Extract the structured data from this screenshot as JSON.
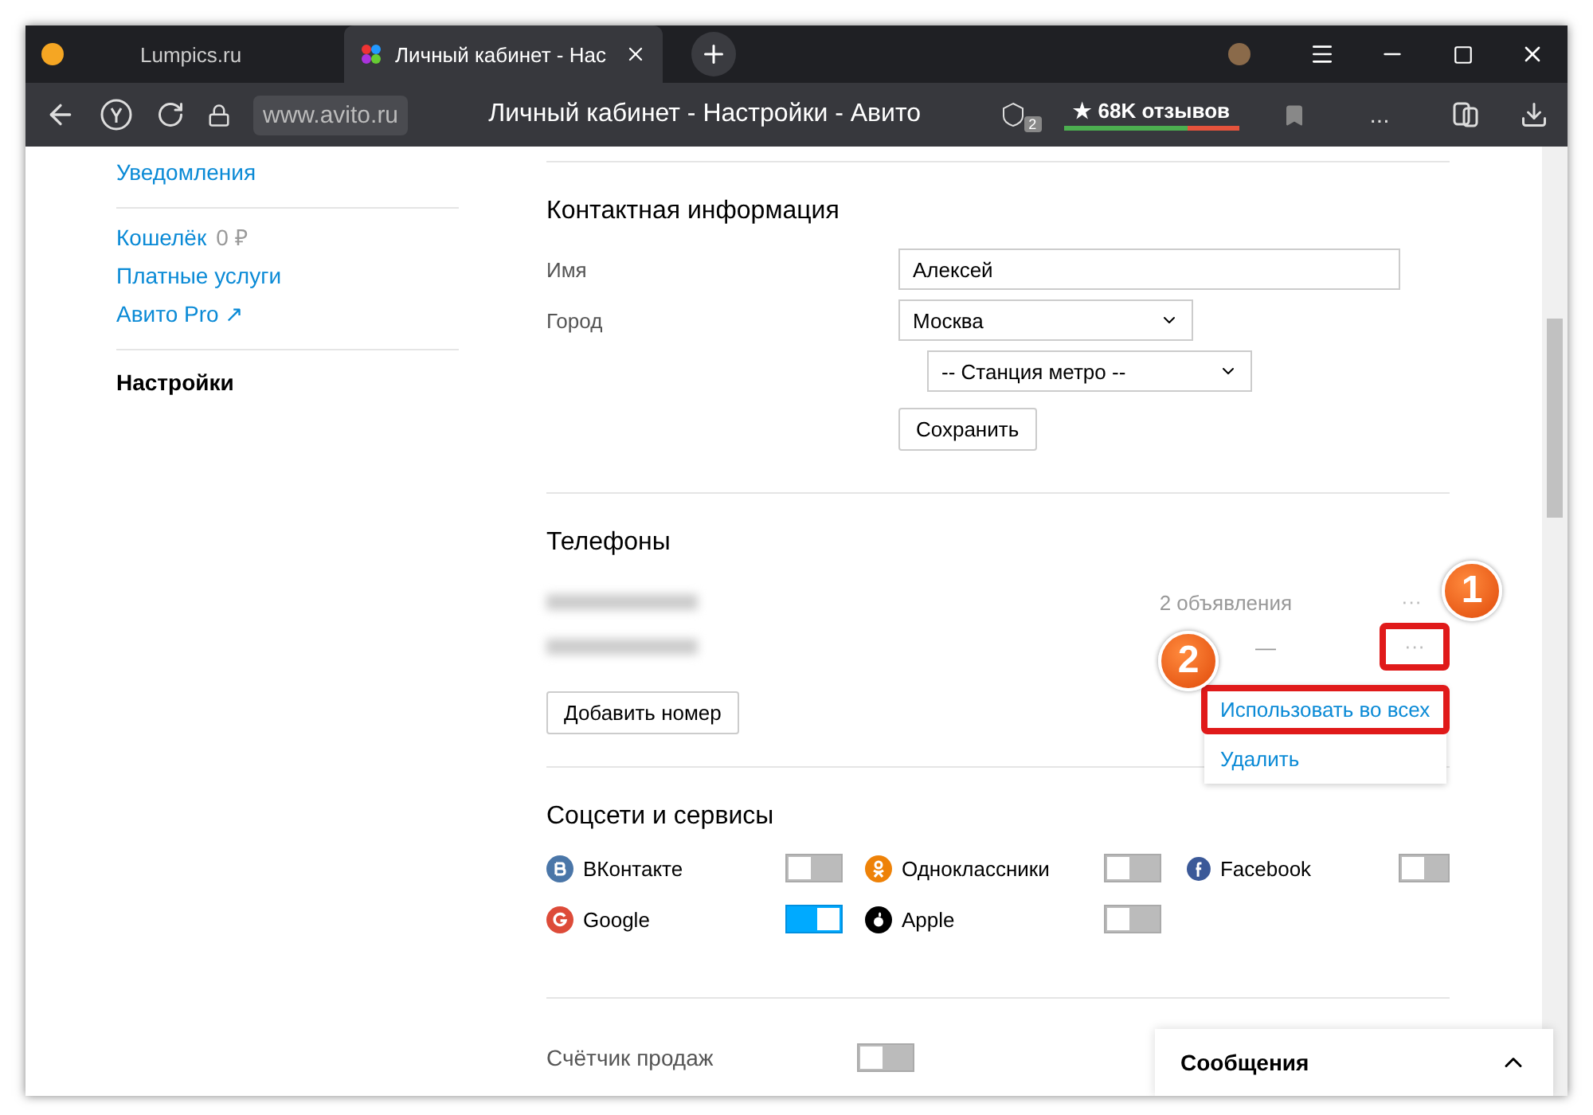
{
  "browser": {
    "tabs": [
      {
        "label": "Lumpics.ru",
        "selected": false
      },
      {
        "label": "Личный кабинет - Нас",
        "selected": true
      }
    ],
    "address": "www.avito.ru",
    "page_title": "Личный кабинет - Настройки - Авито",
    "tab_count": "2",
    "reviews": "★ 68K отзывов",
    "more": "..."
  },
  "sidebar": {
    "groups": [
      [
        {
          "label": "Уведомления",
          "selected": false
        }
      ],
      [
        {
          "label": "Кошелёк",
          "suffix": "0 ₽",
          "selected": false
        },
        {
          "label": "Платные услуги",
          "selected": false
        },
        {
          "label": "Авито Pro ↗",
          "selected": false
        }
      ],
      [
        {
          "label": "Настройки",
          "selected": true
        }
      ]
    ]
  },
  "contact": {
    "title": "Контактная информация",
    "name_label": "Имя",
    "name_value": "Алексей",
    "city_label": "Город",
    "city_value": "Москва",
    "metro_value": "-- Станция метро --",
    "save": "Сохранить"
  },
  "phones": {
    "title": "Телефоны",
    "rows": [
      {
        "ads": "2 объявления",
        "more": "···",
        "highlighted": false
      },
      {
        "ads": "—",
        "more": "···",
        "highlighted": true
      }
    ],
    "add": "Добавить номер",
    "menu": [
      {
        "label": "Использовать во всех",
        "highlighted": true
      },
      {
        "label": "Удалить",
        "highlighted": false
      }
    ]
  },
  "social": {
    "title": "Соцсети и сервисы",
    "items": [
      {
        "kind": "vk",
        "label": "ВКонтакте",
        "on": false
      },
      {
        "kind": "ok",
        "label": "Одноклассники",
        "on": false
      },
      {
        "kind": "facebook",
        "label": "Facebook",
        "on": false
      },
      {
        "kind": "google",
        "label": "Google",
        "on": true
      },
      {
        "kind": "apple",
        "label": "Apple",
        "on": false
      }
    ]
  },
  "sales_counter": {
    "label": "Счётчик продаж",
    "on": false
  },
  "messages": {
    "title": "Сообщения"
  },
  "annotations": [
    "1",
    "2"
  ]
}
